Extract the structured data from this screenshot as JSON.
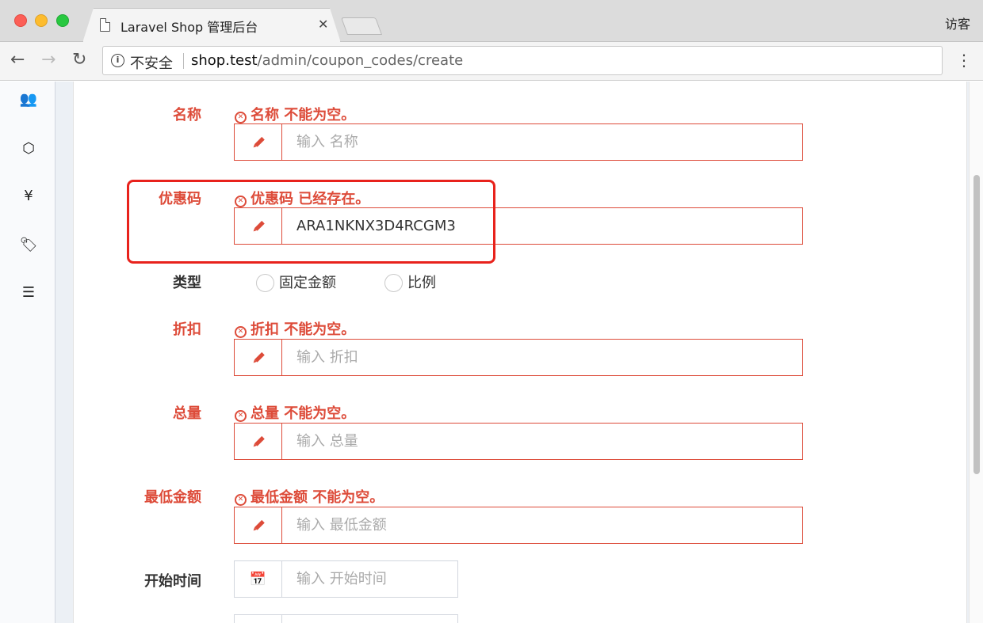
{
  "browser": {
    "tab_title": "Laravel Shop 管理后台",
    "tab_close": "✕",
    "profile": "访客",
    "security_label": "不安全",
    "url_host": "shop.test",
    "url_path": "/admin/coupon_codes/create"
  },
  "sidebar": {
    "items": [
      {
        "icon": "users-icon",
        "glyph": "👥"
      },
      {
        "icon": "cubes-icon",
        "glyph": "⬡"
      },
      {
        "icon": "yen-icon",
        "glyph": "¥"
      },
      {
        "icon": "tags-icon",
        "glyph": "🏷"
      },
      {
        "icon": "tasks-icon",
        "glyph": "☰"
      }
    ]
  },
  "form": {
    "name": {
      "label": "名称",
      "error": "名称 不能为空。",
      "placeholder": "输入 名称",
      "value": ""
    },
    "code": {
      "label": "优惠码",
      "error": "优惠码 已经存在。",
      "value": "ARA1NKNX3D4RCGM3"
    },
    "type": {
      "label": "类型",
      "options": [
        "固定金额",
        "比例"
      ]
    },
    "value": {
      "label": "折扣",
      "error": "折扣 不能为空。",
      "placeholder": "输入 折扣"
    },
    "total": {
      "label": "总量",
      "error": "总量 不能为空。",
      "placeholder": "输入 总量"
    },
    "min_amount": {
      "label": "最低金额",
      "error": "最低金额 不能为空。",
      "placeholder": "输入 最低金额"
    },
    "not_before": {
      "label": "开始时间",
      "placeholder": "输入 开始时间"
    }
  },
  "colors": {
    "error": "#dd4b39",
    "highlight": "#e8221c"
  }
}
